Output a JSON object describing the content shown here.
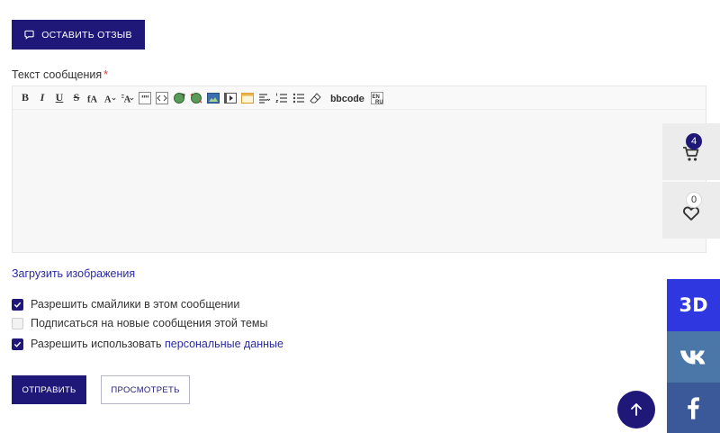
{
  "review_button": {
    "label": "ОСТАВИТЬ ОТЗЫВ",
    "icon": "speech-bubble-icon"
  },
  "message_field": {
    "label": "Текст сообщения",
    "required_mark": "*",
    "value": "",
    "toolbar": [
      {
        "name": "bold",
        "glyph": "B"
      },
      {
        "name": "italic",
        "glyph": "I"
      },
      {
        "name": "underline",
        "glyph": "U"
      },
      {
        "name": "strikethrough",
        "glyph": "S"
      },
      {
        "name": "font-family",
        "glyph": "fA"
      },
      {
        "name": "font-size",
        "glyph": "A▾"
      },
      {
        "name": "font-color",
        "glyph": "A▾"
      },
      {
        "name": "quote",
        "glyph": "quote-icon"
      },
      {
        "name": "code",
        "glyph": "code-icon"
      },
      {
        "name": "link",
        "glyph": "link-icon"
      },
      {
        "name": "unlink",
        "glyph": "unlink-icon"
      },
      {
        "name": "image",
        "glyph": "image-icon"
      },
      {
        "name": "video",
        "glyph": "video-icon"
      },
      {
        "name": "table",
        "glyph": "table-icon"
      },
      {
        "name": "align",
        "glyph": "align-icon"
      },
      {
        "name": "ordered-list",
        "glyph": "ordered-list-icon"
      },
      {
        "name": "unordered-list",
        "glyph": "unordered-list-icon"
      },
      {
        "name": "clear-format",
        "glyph": "eraser-icon"
      },
      {
        "name": "bbcode",
        "glyph": "bbcode"
      },
      {
        "name": "translit",
        "glyph": "translit-icon"
      }
    ]
  },
  "upload_link": "Загрузить изображения",
  "options": {
    "smileys": {
      "label": "Разрешить смайлики в этом сообщении",
      "checked": true
    },
    "subscribe": {
      "label": "Подписаться на новые сообщения этой темы",
      "checked": false
    },
    "personal": {
      "label_prefix": "Разрешить использовать ",
      "link": "персональные данные",
      "checked": true
    }
  },
  "buttons": {
    "submit": "ОТПРАВИТЬ",
    "preview": "ПРОСМОТРЕТЬ"
  },
  "side_panels": {
    "cart": {
      "icon": "cart-icon",
      "count": "4"
    },
    "wishlist": {
      "icon": "heart-icon",
      "count": "0"
    }
  },
  "social": {
    "threed": "3D",
    "vk": "vk-icon",
    "facebook": "facebook-icon"
  },
  "scroll_top": {
    "icon": "arrow-up-icon"
  },
  "colors": {
    "primary": "#201879",
    "link": "#2c2aa0",
    "threed": "#2f37e0",
    "vk": "#4a76a8",
    "facebook": "#3b5998",
    "required": "#e0393e"
  }
}
